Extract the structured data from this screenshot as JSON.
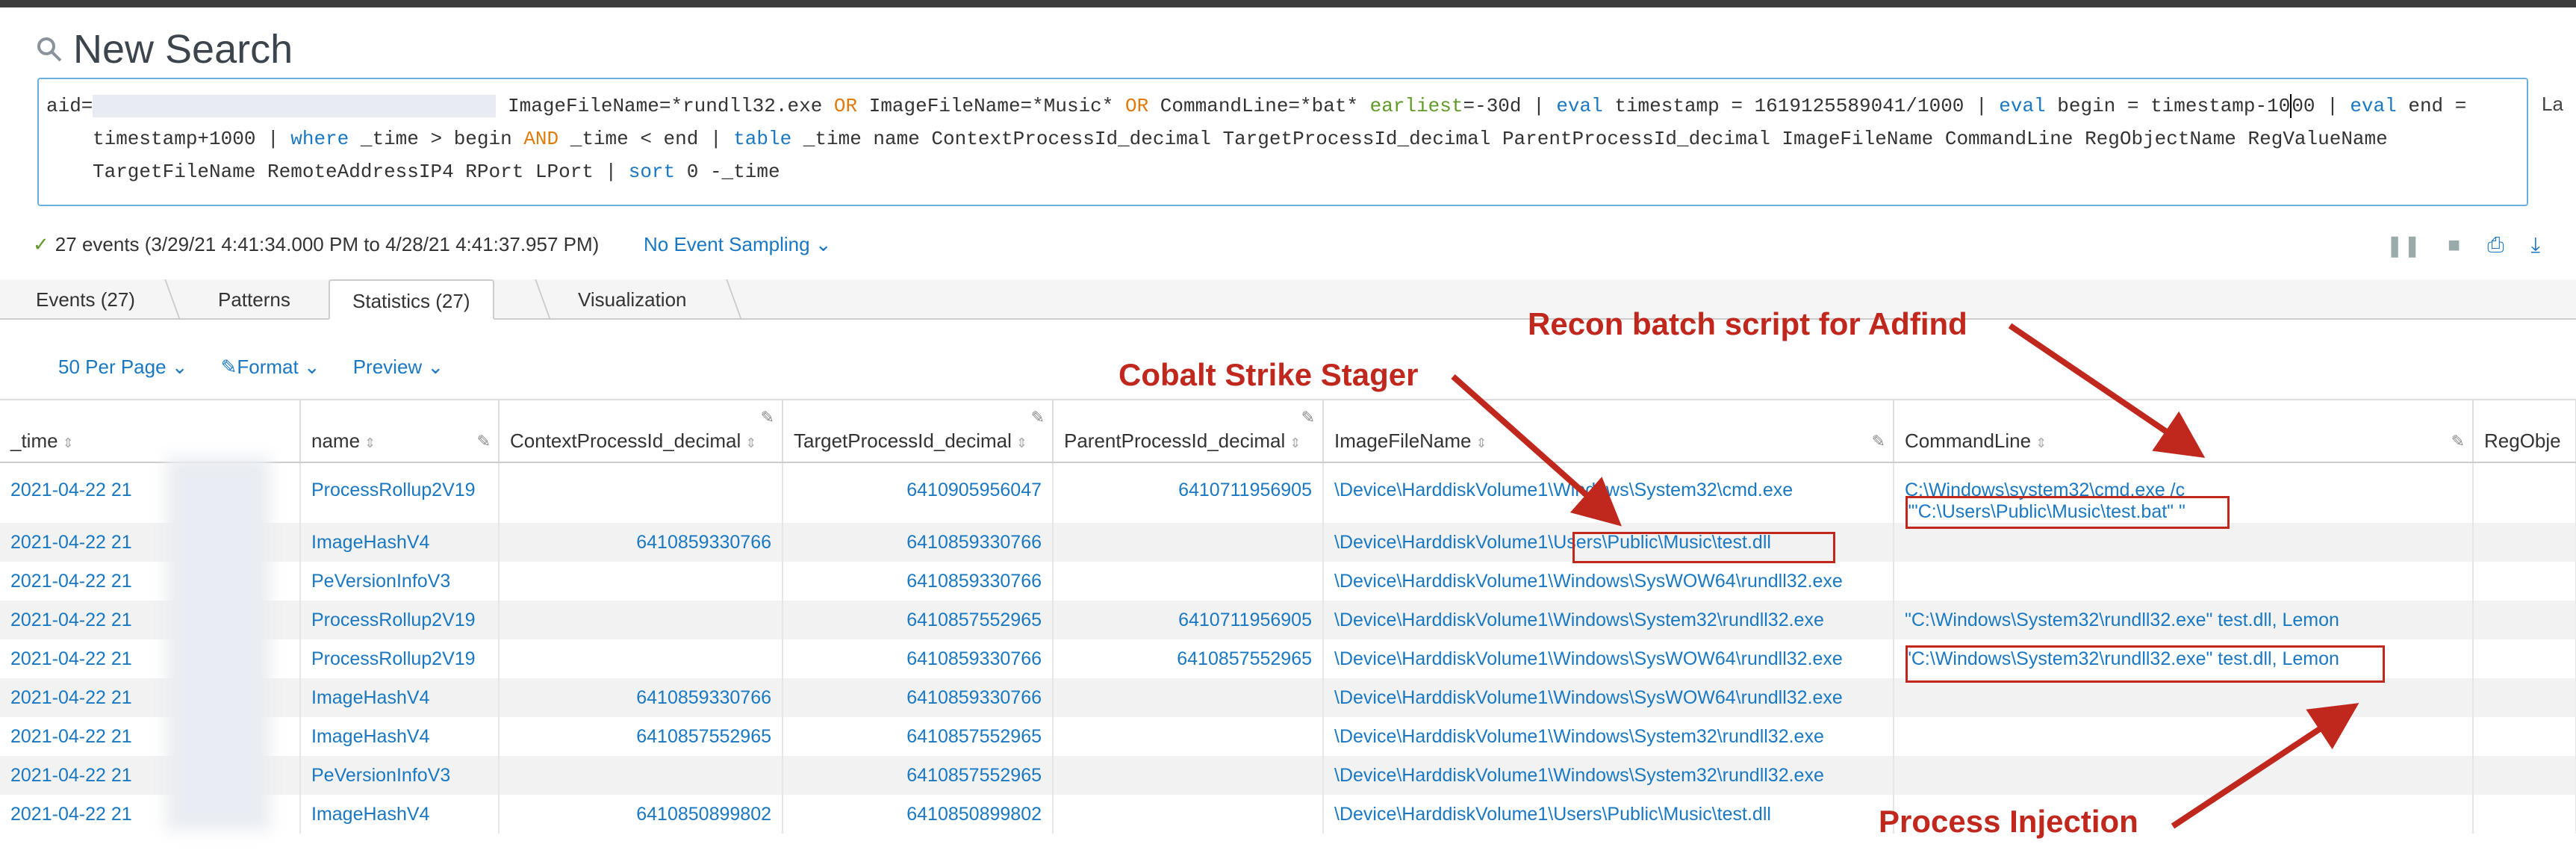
{
  "header": {
    "title": "New Search"
  },
  "search": {
    "line1_prefix": "aid=",
    "line1_mid1": " ImageFileName=*rundll32.exe ",
    "or1": "OR",
    "line1_mid2": " ImageFileName=*Music* ",
    "or2": "OR",
    "line1_mid3": " CommandLine=*bat* ",
    "earliest_kw": "earliest",
    "line1_mid4": "=-30d | ",
    "eval1": "eval",
    "line1_mid5": " timestamp = 1619125589041/1000 | ",
    "eval2": "eval",
    "line1_mid6": " begin = timestamp-10",
    "line1_mid7": "00 | ",
    "eval3": "eval",
    "line1_end": " end =",
    "line2_a": "timestamp+1000 | ",
    "where_kw": "where",
    "line2_b": " _time > begin ",
    "and_kw": "AND",
    "line2_c": " _time < end | ",
    "table_kw": "table",
    "line2_d": " _time name ContextProcessId_decimal TargetProcessId_decimal ParentProcessId_decimal ImageFileName CommandLine RegObjectName RegValueName",
    "line3_a": "TargetFileName RemoteAddressIP4 RPort LPort | ",
    "sort_kw": "sort",
    "line3_b": " 0 -_time"
  },
  "side_label": "La",
  "summary": {
    "check": "✓",
    "text": "27 events (3/29/21 4:41:34.000 PM to 4/28/21 4:41:37.957 PM)",
    "sampling": "No Event Sampling ⌄"
  },
  "tabs": [
    "Events (27)",
    "Patterns",
    "Statistics (27)",
    "Visualization"
  ],
  "viewbar": {
    "per_page": "50 Per Page ⌄",
    "format": "✎Format ⌄",
    "preview": "Preview ⌄"
  },
  "columns": [
    "_time",
    "name",
    "ContextProcessId_decimal",
    "TargetProcessId_decimal",
    "ParentProcessId_decimal",
    "ImageFileName",
    "CommandLine",
    "RegObje"
  ],
  "rows": [
    {
      "time": "2021-04-22 21",
      "name": "ProcessRollup2V19",
      "ctx": "",
      "tgt": "6410905956047",
      "par": "6410711956905",
      "img": "\\Device\\HarddiskVolume1\\Windows\\System32\\cmd.exe",
      "cmd": "C:\\Windows\\system32\\cmd.exe /c",
      "cmd2": "\"\"C:\\Users\\Public\\Music\\test.bat\" \""
    },
    {
      "time": "2021-04-22 21",
      "name": "ImageHashV4",
      "ctx": "6410859330766",
      "tgt": "6410859330766",
      "par": "",
      "img": "\\Device\\HarddiskVolume1\\Users\\Public\\Music\\test.dll",
      "cmd": ""
    },
    {
      "time": "2021-04-22 21",
      "name": "PeVersionInfoV3",
      "ctx": "",
      "tgt": "6410859330766",
      "par": "",
      "img": "\\Device\\HarddiskVolume1\\Windows\\SysWOW64\\rundll32.exe",
      "cmd": ""
    },
    {
      "time": "2021-04-22 21",
      "name": "ProcessRollup2V19",
      "ctx": "",
      "tgt": "6410857552965",
      "par": "6410711956905",
      "img": "\\Device\\HarddiskVolume1\\Windows\\System32\\rundll32.exe",
      "cmd": "\"C:\\Windows\\System32\\rundll32.exe\" test.dll, Lemon"
    },
    {
      "time": "2021-04-22 21",
      "name": "ProcessRollup2V19",
      "ctx": "",
      "tgt": "6410859330766",
      "par": "6410857552965",
      "img": "\\Device\\HarddiskVolume1\\Windows\\SysWOW64\\rundll32.exe",
      "cmd": "\"C:\\Windows\\System32\\rundll32.exe\" test.dll, Lemon"
    },
    {
      "time": "2021-04-22 21",
      "name": "ImageHashV4",
      "ctx": "6410859330766",
      "tgt": "6410859330766",
      "par": "",
      "img": "\\Device\\HarddiskVolume1\\Windows\\SysWOW64\\rundll32.exe",
      "cmd": ""
    },
    {
      "time": "2021-04-22 21",
      "name": "ImageHashV4",
      "ctx": "6410857552965",
      "tgt": "6410857552965",
      "par": "",
      "img": "\\Device\\HarddiskVolume1\\Windows\\System32\\rundll32.exe",
      "cmd": ""
    },
    {
      "time": "2021-04-22 21",
      "name": "PeVersionInfoV3",
      "ctx": "",
      "tgt": "6410857552965",
      "par": "",
      "img": "\\Device\\HarddiskVolume1\\Windows\\System32\\rundll32.exe",
      "cmd": ""
    },
    {
      "time": "2021-04-22 21",
      "name": "ImageHashV4",
      "ctx": "6410850899802",
      "tgt": "6410850899802",
      "par": "",
      "img": "\\Device\\HarddiskVolume1\\Users\\Public\\Music\\test.dll",
      "cmd": ""
    }
  ],
  "annotations": {
    "recon": "Recon batch script for Adfind",
    "cobalt": "Cobalt Strike Stager",
    "injection": "Process Injection"
  },
  "colors": {
    "link": "#1a78c2",
    "annotation": "#c0281e",
    "accent_green": "#629a28",
    "keyword_orange": "#e07b0c"
  }
}
